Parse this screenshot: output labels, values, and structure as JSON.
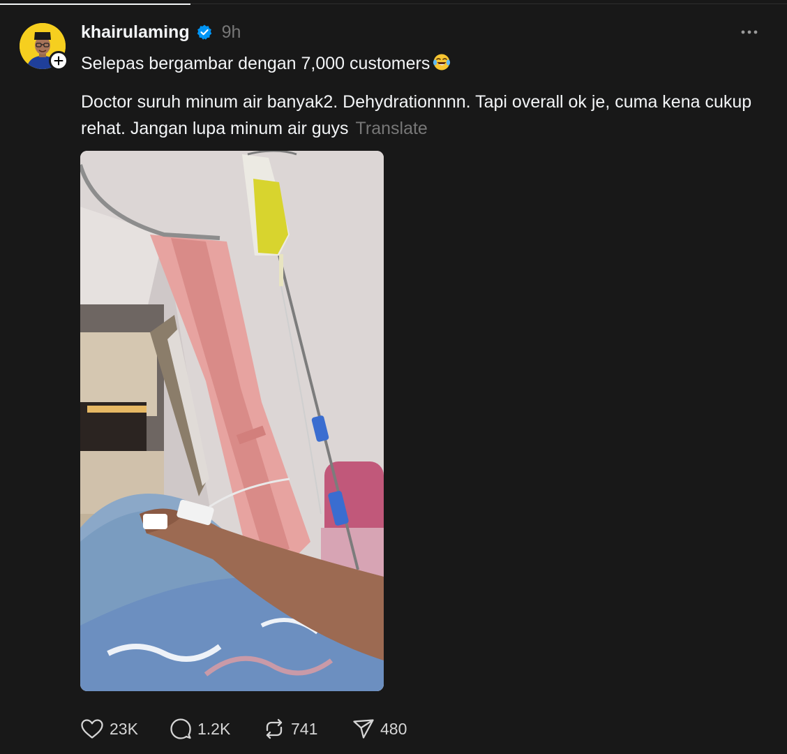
{
  "post": {
    "username": "khairulaming",
    "time": "9h",
    "text_line1": "Selepas bergambar dengan 7,000 customers",
    "emoji": "face-with-tears-of-joy",
    "text_line2": "Doctor suruh minum air banyak2. Dehydrationnnn. Tapi overall ok je, cuma kena cukup rehat. Jangan lupa minum air guys",
    "translate_label": "Translate"
  },
  "actions": {
    "likes": "23K",
    "replies": "1.2K",
    "reposts": "741",
    "shares": "480"
  },
  "icons": {
    "verified": "verified-badge-icon",
    "more": "more-horizontal-icon",
    "follow": "plus-icon",
    "like": "heart-icon",
    "reply": "comment-icon",
    "repost": "repost-icon",
    "share": "send-icon"
  },
  "colors": {
    "background": "#181818",
    "text": "#f3f5f7",
    "muted": "#777777",
    "verified": "#0095f6",
    "avatar_bg": "#f6cf1f"
  }
}
